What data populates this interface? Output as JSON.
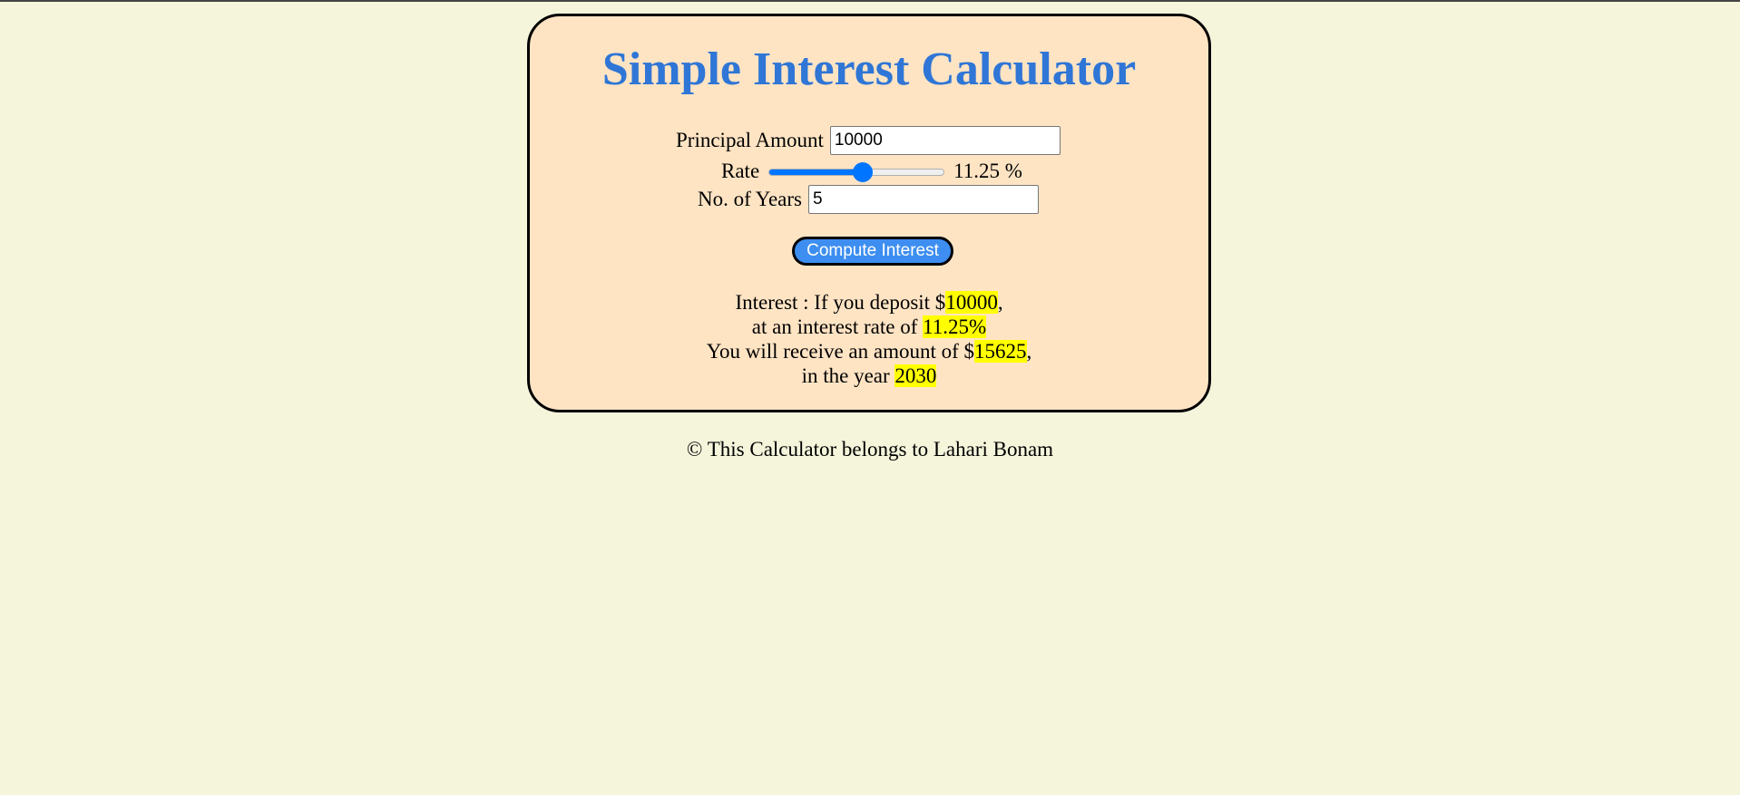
{
  "title": "Simple Interest Calculator",
  "form": {
    "principal_label": "Principal Amount",
    "principal_value": "10000",
    "rate_label": "Rate",
    "rate_value": 11.25,
    "rate_display": "11.25 %",
    "rate_slider_fraction": 0.54,
    "years_label": "No. of Years",
    "years_value": "5",
    "compute_label": "Compute Interest"
  },
  "result": {
    "line1_prefix": "Interest : If you deposit $",
    "deposit": "10000",
    "line1_suffix": ",",
    "line2_prefix": "at an interest rate of ",
    "rate": "11.25%",
    "line3_prefix": "You will receive an amount of $",
    "amount": "15625",
    "line3_suffix": ",",
    "line4_prefix": "in the year ",
    "year": "2030"
  },
  "footer": "© This Calculator belongs to Lahari Bonam",
  "colors": {
    "background": "#f5f5dc",
    "card": "#ffe4c4",
    "title": "#2f76d6",
    "button": "#3d8ef0",
    "slider": "#0075ff",
    "highlight": "#ffff00"
  }
}
